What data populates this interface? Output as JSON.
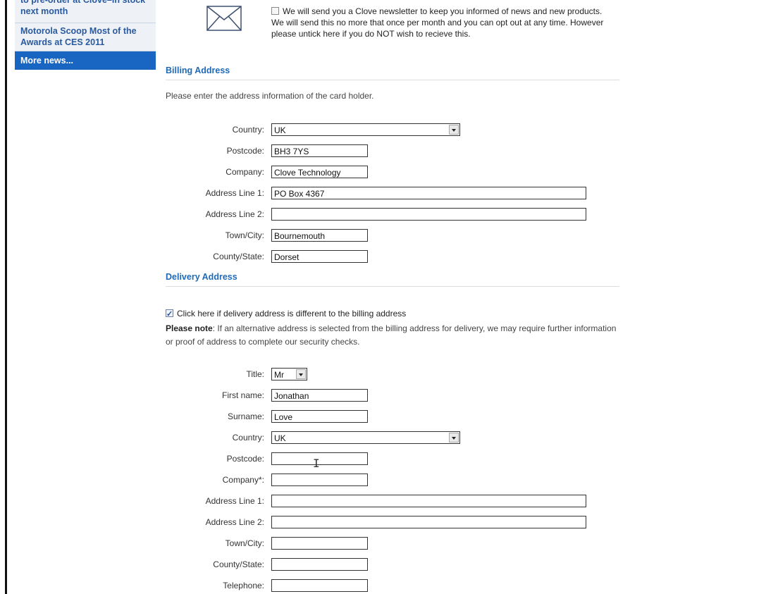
{
  "sidebar": {
    "items": [
      {
        "label": "to pre-order at Clove–in stock next month"
      },
      {
        "label": "Motorola Scoop Most of the Awards at CES 2011"
      }
    ],
    "more_news": "More news..."
  },
  "newsletter": {
    "icon": "envelope-icon",
    "text": "We will send you a Clove newsletter to keep you informed of news and new products. We will send this no more that once per month and you can opt out at any time. However please untick here if you do NOT wish to recieve this.",
    "checked": false
  },
  "billing": {
    "title": "Billing Address",
    "intro": "Please enter the address information of the card holder.",
    "fields": {
      "country": {
        "label": "Country:",
        "value": "UK"
      },
      "postcode": {
        "label": "Postcode:",
        "value": "BH3 7YS"
      },
      "company": {
        "label": "Company:",
        "value": "Clove Technology"
      },
      "address1": {
        "label": "Address Line 1:",
        "value": "PO Box 4367"
      },
      "address2": {
        "label": "Address Line 2:",
        "value": ""
      },
      "town": {
        "label": "Town/City:",
        "value": "Bournemouth"
      },
      "county": {
        "label": "County/State:",
        "value": "Dorset"
      }
    }
  },
  "delivery": {
    "title": "Delivery Address",
    "different_checkbox": {
      "label": "Click here if delivery address is different to the billing address",
      "checked": true
    },
    "note_bold": "Please note",
    "note_text": ": If an alternative address is selected from the billing address for delivery, we may require further information or proof of address to complete our security checks.",
    "fields": {
      "title": {
        "label": "Title:",
        "value": "Mr"
      },
      "first_name": {
        "label": "First name:",
        "value": "Jonathan"
      },
      "surname": {
        "label": "Surname:",
        "value": "Love"
      },
      "country": {
        "label": "Country:",
        "value": "UK"
      },
      "postcode": {
        "label": "Postcode:",
        "value": ""
      },
      "company": {
        "label": "Company*:",
        "value": ""
      },
      "address1": {
        "label": "Address Line 1:",
        "value": ""
      },
      "address2": {
        "label": "Address Line 2:",
        "value": ""
      },
      "town": {
        "label": "Town/City:",
        "value": ""
      },
      "county": {
        "label": "County/State:",
        "value": ""
      },
      "telephone": {
        "label": "Telephone:",
        "value": ""
      }
    }
  }
}
